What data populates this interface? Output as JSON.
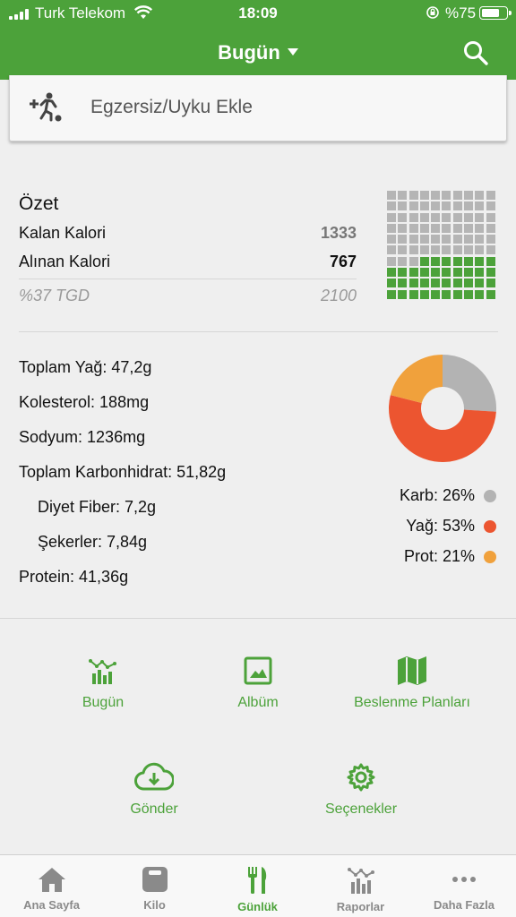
{
  "status_bar": {
    "carrier": "Turk Telekom",
    "time": "18:09",
    "battery_percent": "%75",
    "battery_level": 0.75
  },
  "header": {
    "title": "Bugün",
    "search_icon": "search-icon"
  },
  "exercise": {
    "label": "Egzersiz/Uyku Ekle",
    "icon": "add-exercise-icon"
  },
  "summary": {
    "title": "Özet",
    "remaining_label": "Kalan Kalori",
    "remaining_value": "1333",
    "taken_label": "Alınan Kalori",
    "taken_value": "767",
    "tgd_label": "%37 TGD",
    "tgd_value": "2100",
    "waffle_filled_fraction": 0.37,
    "waffle_filled_color": "#4ca23a",
    "waffle_empty_color": "#b5b5b5"
  },
  "nutrients": {
    "fat": "Toplam Yağ: 47,2g",
    "cholesterol": "Kolesterol: 188mg",
    "sodium": "Sodyum: 1236mg",
    "carbs": "Toplam Karbonhidrat: 51,82g",
    "fiber": "Diyet Fiber: 7,2g",
    "sugars": "Şekerler: 7,84g",
    "protein": "Protein: 41,36g"
  },
  "macros": [
    {
      "label": "Karb: 26%",
      "percent": 26,
      "color": "#b3b3b3"
    },
    {
      "label": "Yağ: 53%",
      "percent": 53,
      "color": "#ec5530"
    },
    {
      "label": "Prot: 21%",
      "percent": 21,
      "color": "#f0a13c"
    }
  ],
  "shortcuts": {
    "today": "Bugün",
    "album": "Albüm",
    "plans": "Beslenme Planları",
    "send": "Gönder",
    "options": "Seçenekler"
  },
  "tabs": {
    "home": "Ana Sayfa",
    "weight": "Kilo",
    "diary": "Günlük",
    "reports": "Raporlar",
    "more": "Daha Fazla",
    "active": "diary"
  },
  "colors": {
    "accent": "#4ca23a",
    "inactive": "#8a8a8a"
  }
}
